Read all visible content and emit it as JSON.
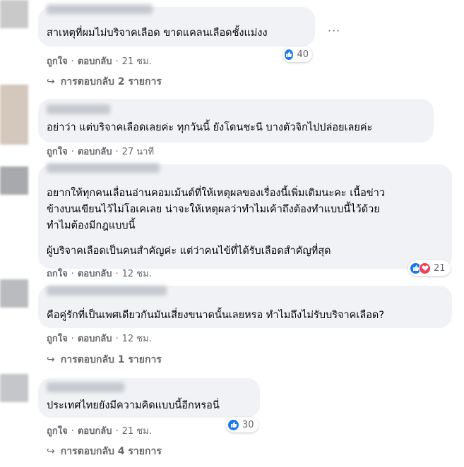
{
  "comments": [
    {
      "text": [
        "สาเหตุที่ผมไม่บริจาคเลือด ขาดแคลนเลือดชั้งแม่งง"
      ],
      "like": "ถูกใจ",
      "reply": "ตอบกลับ",
      "time": "21 ชม.",
      "reaction_count": "40",
      "reactions": [
        "like-icon"
      ],
      "replies": "การตอบกลับ 2 รายการ"
    },
    {
      "text": [
        "อย่าว่า แต่บริจาคเลือดเลยค่ะ ทุกวันนี้ ยังโดนชะนี บางตัวจิกไปปล่อยเลยค่ะ"
      ],
      "like": "ถูกใจ",
      "reply": "ตอบกลับ",
      "time": "27 นาที"
    },
    {
      "text": [
        "อยากให้ทุกคนเลื่อนอ่านคอมเม้นต์ที่ให้เหตุผลของเรื่องนี้เพิ่มเติมนะคะ เนื้อข่าว",
        "ข้างบนเขียนไว้ไม่โอเคเลย น่าจะให้เหตุผลว่าทำไมเค้าถึงต้องทำแบบนี้ไว้ด้วย",
        "ทำไมต้องมีกฎแบบนี้",
        "ผู้บริจาคเลือดเป็นคนสำคัญค่ะ แต่ว่าคนไข้ที่ได้รับเลือดสำคัญที่สุด"
      ],
      "like": "ถูกใจ",
      "reply": "ตอบกลับ",
      "time": "12 ชม.",
      "reaction_count": "21",
      "reactions": [
        "like-icon",
        "love-icon"
      ]
    },
    {
      "text": [
        "คือคู่รักที่เป็นเพศเดียวกันมันเสี่ยงขนาดนั้นเลยหรอ ทำไมถึงไม่รับบริจาคเลือด?"
      ],
      "like": "ถูกใจ",
      "reply": "ตอบกลับ",
      "time": "12 ชม.",
      "replies": "การตอบกลับ 1 รายการ"
    },
    {
      "text": [
        "ประเทศไทยยังมีความคิดแบบนี้อีกหรอนี่"
      ],
      "like": "ถูกใจ",
      "reply": "ตอบกลับ",
      "time": "21 ชม.",
      "reaction_count": "30",
      "reactions": [
        "like-icon"
      ],
      "replies": "การตอบกลับ 4 รายการ"
    }
  ],
  "more_label": "···",
  "reply_arrow": "↪",
  "colors": {
    "bubble": "#f0f2f5",
    "meta": "#65676b",
    "like": "#1877f2",
    "love": "#f33e58"
  }
}
